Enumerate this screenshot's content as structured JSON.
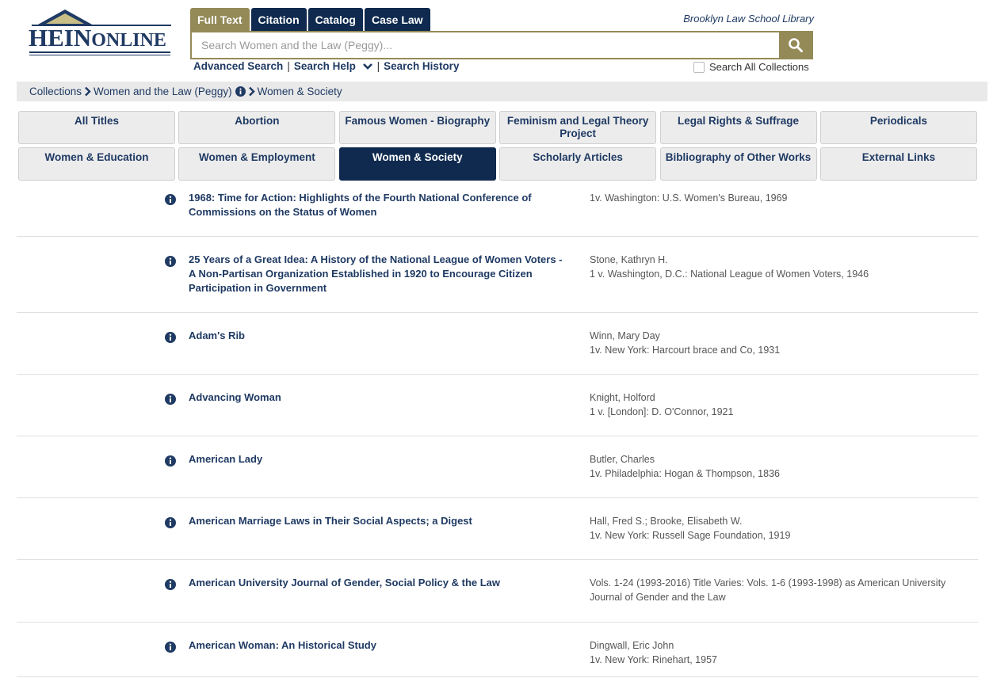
{
  "logo": {
    "text_main": "HEIN",
    "text_sub": "ONLINE"
  },
  "search_tabs": [
    {
      "label": "Full Text",
      "active": true
    },
    {
      "label": "Citation",
      "active": false
    },
    {
      "label": "Catalog",
      "active": false
    },
    {
      "label": "Case Law",
      "active": false
    }
  ],
  "library_name": "Brooklyn Law School Library",
  "search": {
    "placeholder": "Search Women and the Law (Peggy)...",
    "links": [
      "Advanced Search",
      "Search Help",
      "Search History"
    ],
    "search_all_label": "Search All Collections"
  },
  "breadcrumb": [
    "Collections",
    "Women and the Law (Peggy)",
    "Women & Society"
  ],
  "categories": [
    {
      "label": "All Titles",
      "active": false
    },
    {
      "label": "Abortion",
      "active": false
    },
    {
      "label": "Famous Women - Biography",
      "active": false
    },
    {
      "label": "Feminism and Legal Theory Project",
      "active": false
    },
    {
      "label": "Legal Rights & Suffrage",
      "active": false
    },
    {
      "label": "Periodicals",
      "active": false
    },
    {
      "label": "Women & Education",
      "active": false
    },
    {
      "label": "Women & Employment",
      "active": false
    },
    {
      "label": "Women & Society",
      "active": true
    },
    {
      "label": "Scholarly Articles",
      "active": false
    },
    {
      "label": "Bibliography of Other Works",
      "active": false
    },
    {
      "label": "External Links",
      "active": false
    }
  ],
  "titles": [
    {
      "title": "1968: Time for Action: Highlights of the Fourth National Conference of Commissions on the Status of Women",
      "author": "",
      "pub": "1v. Washington: U.S. Women's Bureau, 1969"
    },
    {
      "title": "25 Years of a Great Idea: A History of the National League of Women Voters - A Non-Partisan Organization Established in 1920 to Encourage Citizen Participation in Government",
      "author": "Stone, Kathryn H.",
      "pub": "1 v. Washington, D.C.: National League of Women Voters, 1946"
    },
    {
      "title": "Adam's Rib",
      "author": "Winn, Mary Day",
      "pub": "1v. New York: Harcourt brace and Co, 1931"
    },
    {
      "title": "Advancing Woman",
      "author": "Knight, Holford",
      "pub": "1 v. [London]: D. O'Connor, 1921"
    },
    {
      "title": "American Lady",
      "author": "Butler, Charles",
      "pub": "1v. Philadelphia: Hogan & Thompson, 1836"
    },
    {
      "title": "American Marriage Laws in Their Social Aspects; a Digest",
      "author": "Hall, Fred S.; Brooke, Elisabeth W.",
      "pub": "1v. New York: Russell Sage Foundation, 1919"
    },
    {
      "title": "American University Journal of Gender, Social Policy & the Law",
      "author": "Vols. 1-24 (1993-2016) Title Varies: Vols. 1-6 (1993-1998) as American University Journal of Gender and the Law",
      "pub": ""
    },
    {
      "title": "American Woman: An Historical Study",
      "author": "Dingwall, Eric John",
      "pub": "1v. New York: Rinehart, 1957"
    }
  ]
}
